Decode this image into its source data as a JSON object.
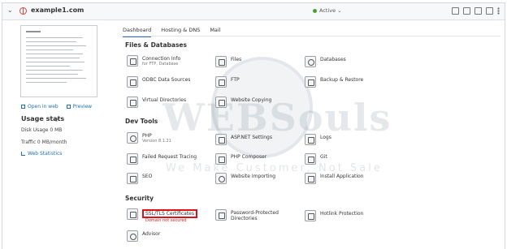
{
  "header": {
    "domain": "example1.com",
    "status": "Active"
  },
  "left": {
    "open_in_web": "Open in web",
    "preview": "Preview",
    "usage_title": "Usage stats",
    "disk_usage": "Disk Usage 0 MB",
    "traffic": "Traffic 0 MB/month",
    "web_statistics": "Web Statistics"
  },
  "tabs": [
    "Dashboard",
    "Hosting & DNS",
    "Mail"
  ],
  "sections": {
    "files": "Files & Databases",
    "dev": "Dev Tools",
    "security": "Security"
  },
  "files_items": [
    {
      "label": "Connection Info",
      "sub": "for FTP, Database"
    },
    {
      "label": "Files"
    },
    {
      "label": "Databases"
    },
    {
      "label": "ODBC Data Sources"
    },
    {
      "label": "FTP"
    },
    {
      "label": "Backup & Restore"
    },
    {
      "label": "Virtual Directories"
    },
    {
      "label": "Website Copying"
    }
  ],
  "dev_items": [
    {
      "label": "PHP",
      "sub": "Version 8.1.21"
    },
    {
      "label": "ASP.NET Settings"
    },
    {
      "label": "Logs"
    },
    {
      "label": "Failed Request Tracing"
    },
    {
      "label": "PHP Composer"
    },
    {
      "label": "Git"
    },
    {
      "label": "SEO"
    },
    {
      "label": "Website Importing"
    },
    {
      "label": "Install Application"
    }
  ],
  "security_items": [
    {
      "label": "SSL/TLS Certificates",
      "sub": "Domain not secured"
    },
    {
      "label": "Password-Protected",
      "label2": "Directories"
    },
    {
      "label": "Hotlink Protection"
    },
    {
      "label": "Advisor"
    }
  ],
  "watermark": {
    "brand": "WEBSouls",
    "tagline": "We Make Customer, Not Sale"
  },
  "colors": {
    "accent": "#2d6fb7",
    "highlight": "#e0111b",
    "active": "#4a9e34"
  }
}
